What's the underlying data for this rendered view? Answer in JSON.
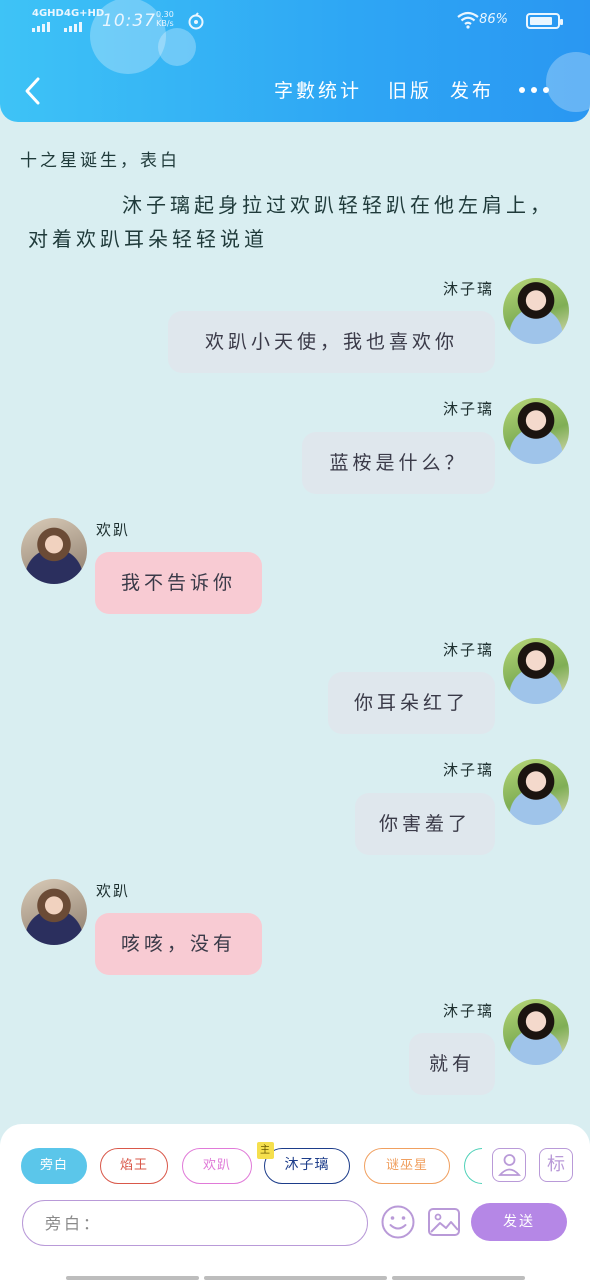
{
  "status_bar": {
    "signal_1": "4GHD",
    "signal_2": "4G+HD",
    "time": "10:37",
    "net_speed": "0.30",
    "net_unit": "KB/s",
    "battery_percent": "86%",
    "battery_level": 0.86
  },
  "header": {
    "word_count": "字數统计",
    "old_version": "旧版",
    "publish": "发布"
  },
  "story": {
    "title": "十之星诞生，表白",
    "narration": "沐子璃起身拉过欢趴轻轻趴在他左肩上，对着欢趴耳朵轻轻说道"
  },
  "messages": [
    {
      "sender": "沐子璃",
      "text": "欢趴小天使，我也喜欢你",
      "side": "right"
    },
    {
      "sender": "沐子璃",
      "text": "蓝桉是什么？",
      "side": "right"
    },
    {
      "sender": "欢趴",
      "text": "我不告诉你",
      "side": "left"
    },
    {
      "sender": "沐子璃",
      "text": "你耳朵红了",
      "side": "right"
    },
    {
      "sender": "沐子璃",
      "text": "你害羞了",
      "side": "right"
    },
    {
      "sender": "欢趴",
      "text": "咳咳，没有",
      "side": "left"
    },
    {
      "sender": "沐子璃",
      "text": "就有",
      "side": "right"
    }
  ],
  "role_chips": [
    {
      "label": "旁白",
      "color": "#5bc6ea"
    },
    {
      "label": "焰王",
      "color": "#d9584a"
    },
    {
      "label": "欢趴",
      "color": "#e07ad8"
    },
    {
      "label": "沐子璃",
      "color": "#1d3d8a",
      "badge": "主"
    },
    {
      "label": "谜巫星",
      "color": "#f0a060"
    }
  ],
  "input": {
    "placeholder": "旁白："
  },
  "send_label": "发送",
  "mark_label": "标"
}
